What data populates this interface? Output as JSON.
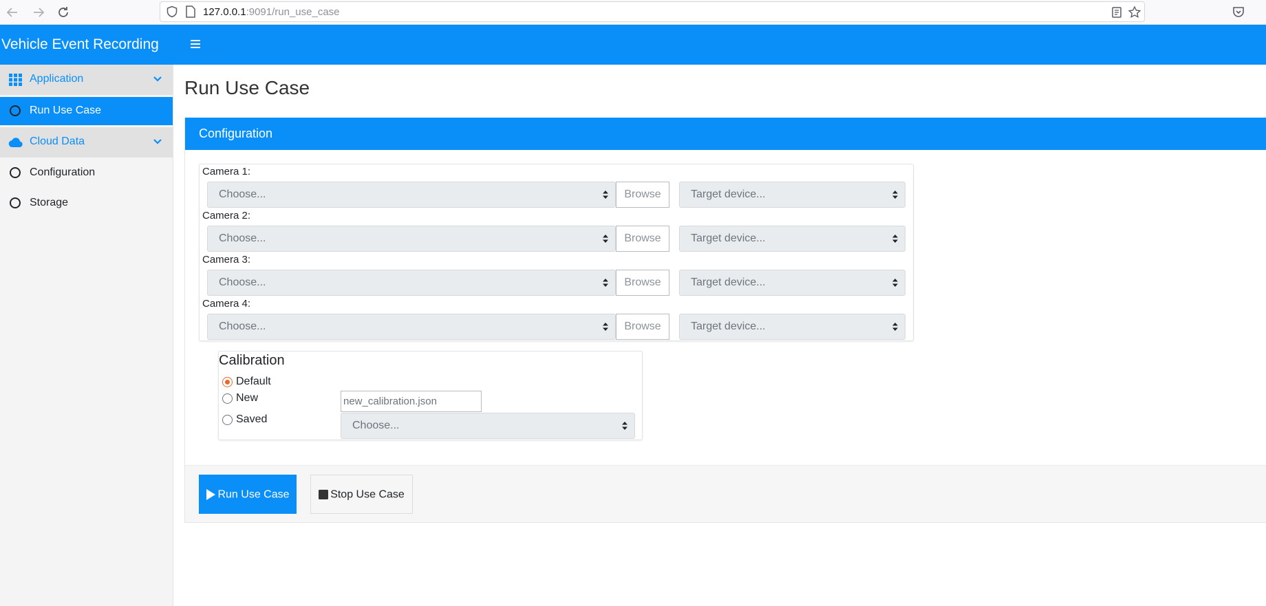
{
  "browser": {
    "url_host": "127.0.0.1",
    "url_rest": ":9091/run_use_case"
  },
  "app": {
    "brand": "Vehicle Event Recording"
  },
  "sidebar": {
    "groups": [
      {
        "label": "Application",
        "icon": "grid-icon"
      },
      {
        "label": "Cloud Data",
        "icon": "cloud-icon"
      }
    ],
    "items": [
      {
        "label": "Run Use Case",
        "active": true
      },
      {
        "label": "Configuration",
        "active": false
      },
      {
        "label": "Storage",
        "active": false
      }
    ]
  },
  "main": {
    "title": "Run Use Case",
    "card_header": "Configuration",
    "cameras": [
      {
        "label": "Camera 1:",
        "source_placeholder": "Choose...",
        "browse_label": "Browse",
        "target_placeholder": "Target device..."
      },
      {
        "label": "Camera 2:",
        "source_placeholder": "Choose...",
        "browse_label": "Browse",
        "target_placeholder": "Target device..."
      },
      {
        "label": "Camera 3:",
        "source_placeholder": "Choose...",
        "browse_label": "Browse",
        "target_placeholder": "Target device..."
      },
      {
        "label": "Camera 4:",
        "source_placeholder": "Choose...",
        "browse_label": "Browse",
        "target_placeholder": "Target device..."
      }
    ],
    "calibration": {
      "title": "Calibration",
      "options": [
        "Default",
        "New",
        "Saved"
      ],
      "selected": "Default",
      "new_filename": "new_calibration.json",
      "saved_placeholder": "Choose..."
    },
    "buttons": {
      "run": "Run Use Case",
      "stop": "Stop Use Case"
    }
  },
  "colors": {
    "primary": "#0a8ef8",
    "radio_selected": "#e8692f",
    "sidebar_bg": "#f4f4f4"
  }
}
